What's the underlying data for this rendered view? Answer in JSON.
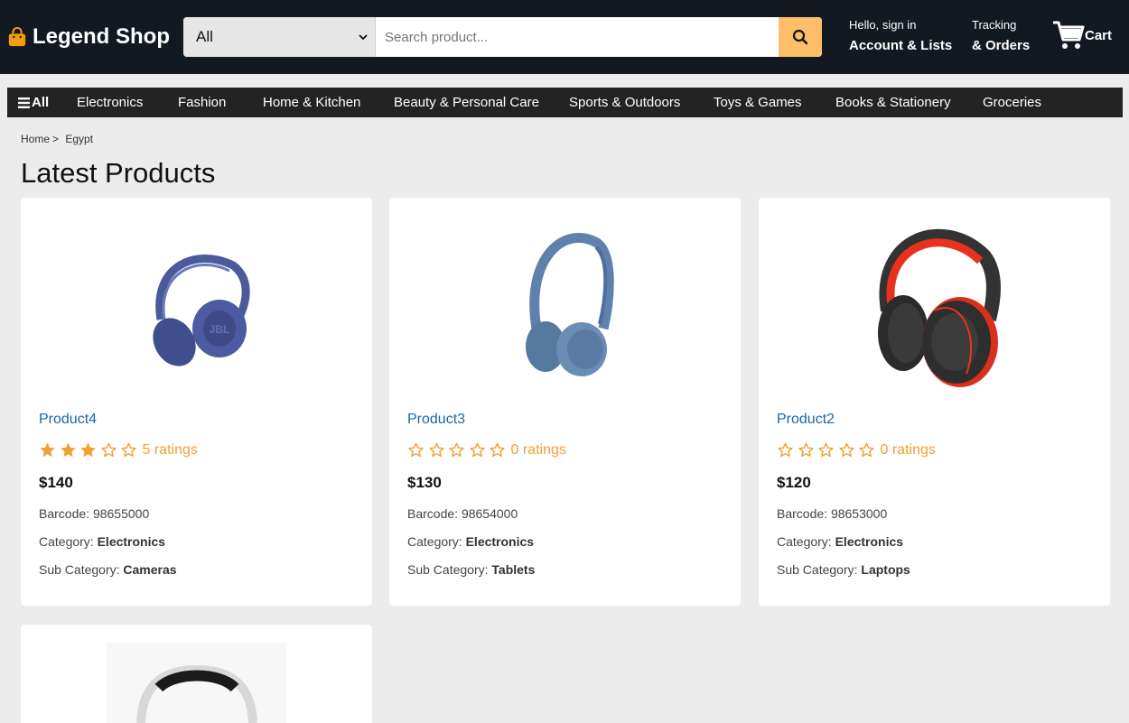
{
  "header": {
    "logo_text": "Legend Shop",
    "search_category": "All",
    "search_placeholder": "Search product...",
    "account_small": "Hello, sign in",
    "account_big": "Account & Lists",
    "orders_small": "Tracking",
    "orders_big": "& Orders",
    "cart_label": "Cart"
  },
  "nav": {
    "all_label": "All",
    "items": [
      "Electronics",
      "Fashion",
      "Home & Kitchen",
      "Beauty & Personal Care",
      "Sports & Outdoors",
      "Toys & Games",
      "Books & Stationery",
      "Groceries"
    ]
  },
  "breadcrumb": {
    "home": "Home",
    "sep": ">",
    "current": "Egypt"
  },
  "page_title": "Latest Products",
  "products": [
    {
      "name": "Product4",
      "stars": 3,
      "ratings": "5 ratings",
      "price": "$140",
      "barcode_label": "Barcode:",
      "barcode": "98655000",
      "category_label": "Category:",
      "category": "Electronics",
      "sub_label": "Sub Category:",
      "sub": "Cameras",
      "image": "blue-headphones-icon"
    },
    {
      "name": "Product3",
      "stars": 0,
      "ratings": "0 ratings",
      "price": "$130",
      "barcode_label": "Barcode:",
      "barcode": "98654000",
      "category_label": "Category:",
      "category": "Electronics",
      "sub_label": "Sub Category:",
      "sub": "Tablets",
      "image": "light-blue-headphones-icon"
    },
    {
      "name": "Product2",
      "stars": 0,
      "ratings": "0 ratings",
      "price": "$120",
      "barcode_label": "Barcode:",
      "barcode": "98653000",
      "category_label": "Category:",
      "category": "Electronics",
      "sub_label": "Sub Category:",
      "sub": "Laptops",
      "image": "red-black-headphones-icon"
    }
  ],
  "colors": {
    "header_bg": "#131921",
    "nav_bg": "#232323",
    "accent": "#febd69",
    "star": "#f0a034",
    "link": "#1668a8"
  }
}
